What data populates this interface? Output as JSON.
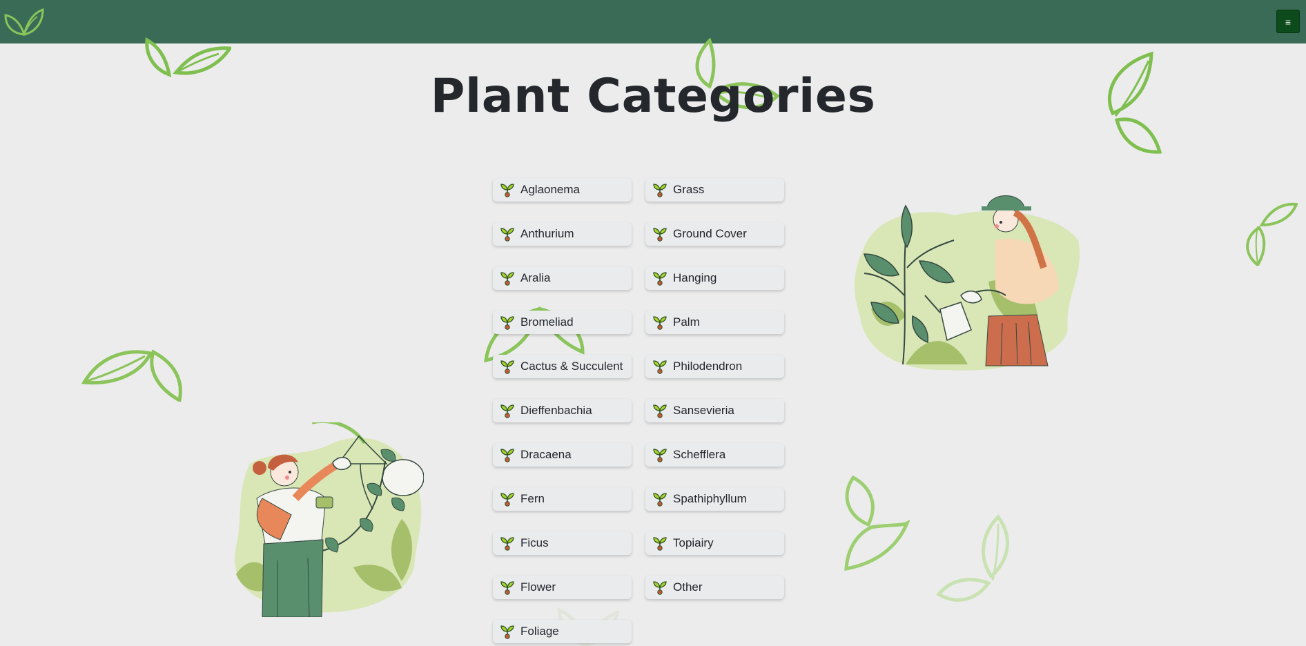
{
  "header": {
    "logo_icon": "leaf-logo-icon",
    "menu_label": "≡",
    "background": "#3a6b57"
  },
  "page": {
    "title": "Plant Categories"
  },
  "categories": [
    "Aglaonema",
    "Grass",
    "Anthurium",
    "Ground Cover",
    "Aralia",
    "Hanging",
    "Bromeliad",
    "Palm",
    "Cactus & Succulent",
    "Philodendron",
    "Dieffenbachia",
    "Sansevieria",
    "Dracaena",
    "Schefflera",
    "Fern",
    "Spathiphyllum",
    "Ficus",
    "Topiairy",
    "Flower",
    "Other",
    "Foliage"
  ],
  "colors": {
    "accent_leaf": "#8ac45a",
    "dark_green": "#0d4a1c",
    "card_bg": "#e9ebed"
  }
}
